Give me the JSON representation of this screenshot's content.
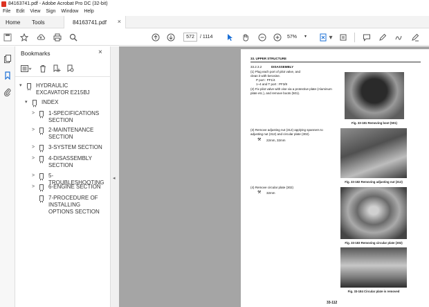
{
  "window": {
    "title": "84163741.pdf - Adobe Acrobat Pro DC (32-bit)"
  },
  "menu": [
    "File",
    "Edit",
    "View",
    "Sign",
    "Window",
    "Help"
  ],
  "tabs": {
    "home": "Home",
    "tools": "Tools",
    "document": "84163741.pdf"
  },
  "toolbar": {
    "page_current": "572",
    "page_total": "/ 1114",
    "zoom": "57%"
  },
  "bookmarks": {
    "title": "Bookmarks",
    "items": [
      {
        "label": "HYDRAULIC EXCAVATOR E215BJ",
        "arrow": "▾"
      },
      {
        "label": "INDEX",
        "arrow": "▾"
      },
      {
        "label": "1-SPECIFICATIONS SECTION",
        "arrow": ">"
      },
      {
        "label": "2-MAINTENANCE SECTION",
        "arrow": ">"
      },
      {
        "label": "3-SYSTEM SECTION",
        "arrow": ">"
      },
      {
        "label": "4-DISASSEMBLY SECTION",
        "arrow": ">"
      },
      {
        "label": "5-TROUBLESHOOTING",
        "arrow": ">"
      },
      {
        "label": "6-ENGINE SECTION",
        "arrow": ">"
      },
      {
        "label": "7-PROCEDURE OF INSTALLING OPTIONS SECTION",
        "arrow": ""
      }
    ]
  },
  "pdf_page": {
    "section": "33. UPPER STRUCTURE",
    "subsection_num": "33.2.3.2",
    "subsection_title": "DISASSEMBLY",
    "step1": "(1) Plug each port of pilot valve, and clean it with kerosine.",
    "step1_ports_p": "P port : PF1/4",
    "step1_ports_t": "1~4 and T port : PF3/8",
    "step2": "(2) Fix pilot valve with vise via a protective plate (Aluminum plate etc.), and remove boots (501).",
    "step3": "(3) Remove adjusting nut (312) applying spanners to adjusting nut (312) and circular plate (302).",
    "step3_tool": "22mm, 32mm",
    "step4": "(4) Remove circular plate (302)",
    "step4_tool": "32mm",
    "fig1": "Fig. 33-181 Removing boot (501)",
    "fig2": "Fig. 33-182 Removing adjusting nut (312)",
    "fig3": "Fig. 33-183 Removing circular plate (302)",
    "fig4": "Fig. 33-184 Circular plate is removed",
    "page_number": "33-112"
  }
}
